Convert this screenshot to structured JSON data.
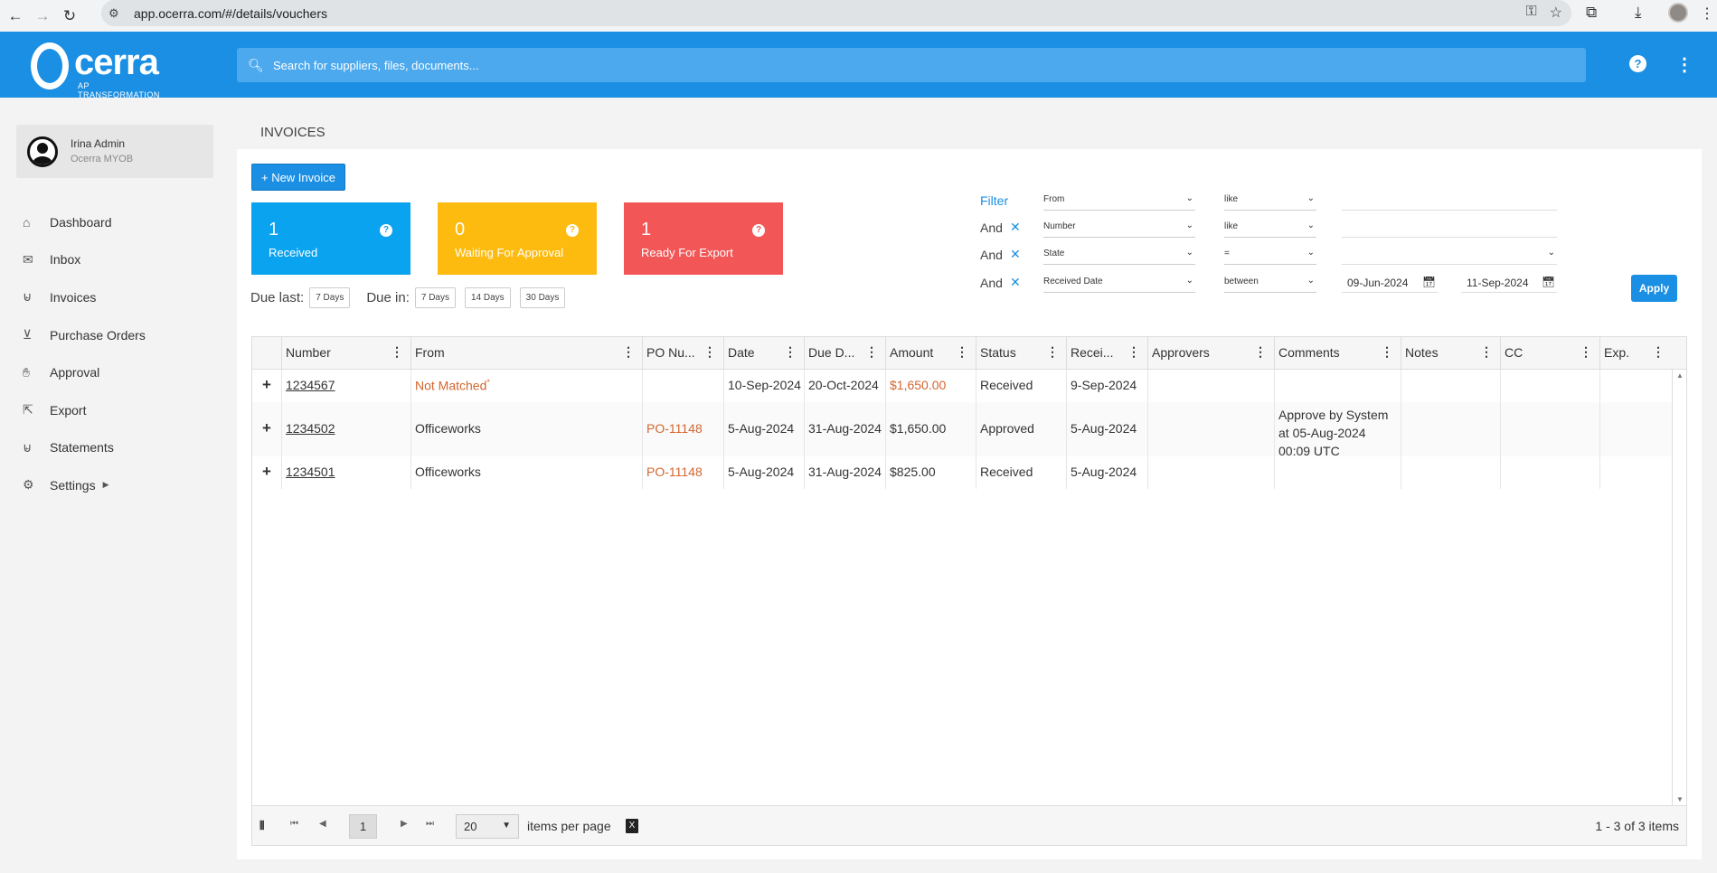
{
  "browser": {
    "url": "app.ocerra.com/#/details/vouchers"
  },
  "header": {
    "logo_text": "cerra",
    "logo_tagline": "AP TRANSFORMATION",
    "search_placeholder": "Search for suppliers, files, documents..."
  },
  "user": {
    "name": "Irina Admin",
    "org": "Ocerra MYOB"
  },
  "sidebar": {
    "items": [
      {
        "label": "Dashboard",
        "icon": "home-icon"
      },
      {
        "label": "Inbox",
        "icon": "inbox-icon"
      },
      {
        "label": "Invoices",
        "icon": "basket-icon"
      },
      {
        "label": "Purchase Orders",
        "icon": "cart-icon"
      },
      {
        "label": "Approval",
        "icon": "thumb-icon"
      },
      {
        "label": "Export",
        "icon": "export-icon"
      },
      {
        "label": "Statements",
        "icon": "basket-icon"
      },
      {
        "label": "Settings",
        "icon": "gear-icon"
      }
    ]
  },
  "page": {
    "title": "INVOICES",
    "new_button": "+ New Invoice"
  },
  "tiles": [
    {
      "count": "1",
      "label": "Received",
      "color": "#0aa3f0"
    },
    {
      "count": "0",
      "label": "Waiting For Approval",
      "color": "#fdbb10"
    },
    {
      "count": "1",
      "label": "Ready For Export",
      "color": "#f25656"
    }
  ],
  "due": {
    "last_label": "Due last:",
    "last_chips": [
      "7 Days"
    ],
    "in_label": "Due in:",
    "in_chips": [
      "7 Days",
      "14 Days",
      "30 Days"
    ]
  },
  "filter": {
    "title": "Filter",
    "and_label": "And",
    "rows": [
      {
        "field": "From",
        "op": "like",
        "value": ""
      },
      {
        "field": "Number",
        "op": "like",
        "value": ""
      },
      {
        "field": "State",
        "op": "=",
        "value": ""
      },
      {
        "field": "Received Date",
        "op": "between",
        "from": "09-Jun-2024",
        "to": "11-Sep-2024"
      }
    ],
    "apply": "Apply"
  },
  "grid": {
    "columns": [
      "Number",
      "From",
      "PO Nu...",
      "Date",
      "Due D...",
      "Amount",
      "Status",
      "Recei...",
      "Approvers",
      "Comments",
      "Notes",
      "CC",
      "Exp."
    ],
    "rows": [
      {
        "number": "1234567",
        "from": "Not Matched",
        "from_mark": "*",
        "po": "",
        "date": "10-Sep-2024",
        "due": "20-Oct-2024",
        "amount": "$1,650.00",
        "status": "Received",
        "received": "9-Sep-2024",
        "approvers": "",
        "comments": "",
        "notes": "",
        "cc": "",
        "exp": ""
      },
      {
        "number": "1234502",
        "from": "Officeworks",
        "po": "PO-11148",
        "date": "5-Aug-2024",
        "due": "31-Aug-2024",
        "amount": "$1,650.00",
        "status": "Approved",
        "received": "5-Aug-2024",
        "approvers": "",
        "comments": "Approve by System at 05-Aug-2024 00:09 UTC",
        "notes": "",
        "cc": "",
        "exp": ""
      },
      {
        "number": "1234501",
        "from": "Officeworks",
        "po": "PO-11148",
        "date": "5-Aug-2024",
        "due": "31-Aug-2024",
        "amount": "$825.00",
        "status": "Received",
        "received": "5-Aug-2024",
        "approvers": "",
        "comments": "",
        "notes": "",
        "cc": "",
        "exp": ""
      }
    ],
    "expand_symbol": "+"
  },
  "pager": {
    "current": "1",
    "page_size": "20",
    "items_per_page": "items per page",
    "count_text": "1 - 3 of 3 items"
  },
  "colors": {
    "accent": "#1a8fe3",
    "orange": "#d4652e"
  }
}
